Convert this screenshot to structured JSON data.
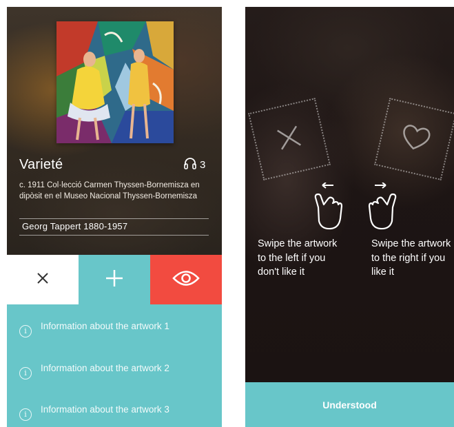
{
  "artwork_screen": {
    "title": "Varieté",
    "audio_count": "3",
    "description": "c. 1911 Col·lecció Carmen Thyssen-Bornemisza en dipòsit en el Museo Nacional Thyssen-Bornemisza",
    "artist": "Georg Tappert 1880-1957",
    "actions": {
      "dislike_icon": "close-icon",
      "add_icon": "plus-icon",
      "view_icon": "eye-icon"
    },
    "info_items": [
      {
        "label": "Information about the artwork 1"
      },
      {
        "label": "Information about the artwork 2"
      },
      {
        "label": "Information about the artwork 3"
      }
    ]
  },
  "tutorial_screen": {
    "left_hint": "Swipe the artwork to the left if you don't like it",
    "right_hint": "Swipe the artwork to the right if you like it",
    "understood_label": "Understood"
  },
  "colors": {
    "teal": "#68c6c9",
    "red": "#f24b40",
    "white": "#ffffff"
  }
}
